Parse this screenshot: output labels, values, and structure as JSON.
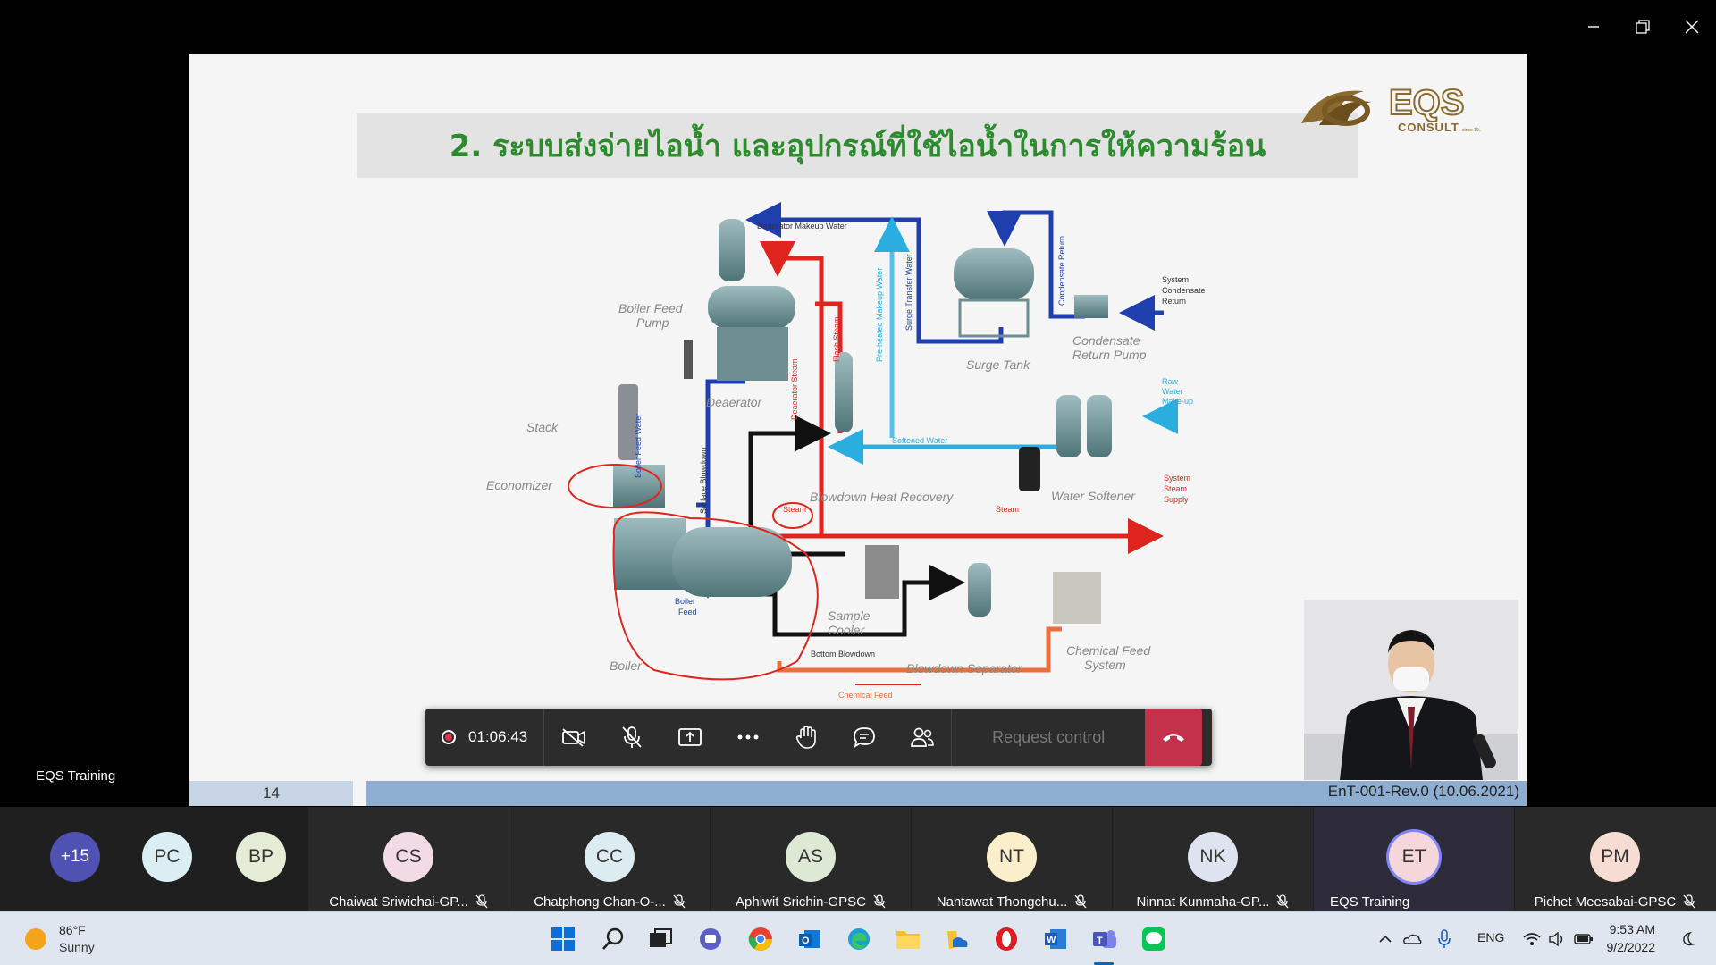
{
  "window": {
    "minimize": "minimize-icon",
    "restore": "restore-icon",
    "close": "close-icon"
  },
  "slide": {
    "title": "2. ระบบส่งจ่ายไอน้ำ และอุปกรณ์ที่ใช้ไอน้ำในการให้ความร้อน",
    "logo_brand": "EQS",
    "logo_sub": "CONSULT",
    "logo_since": "since 19..",
    "page_number": "14",
    "doc_code": "EnT-001-Rev.0 (10.06.2021)",
    "diagram": {
      "labels": {
        "boiler_feed_pump": [
          "Boiler Feed",
          "Pump"
        ],
        "deaerator": "Deaerator",
        "stack": "Stack",
        "economizer": "Economizer",
        "boiler": "Boiler",
        "blowdown_heat_recovery": "Blowdown Heat Recovery",
        "surge_tank": "Surge Tank",
        "condensate_return_pump": [
          "Condensate",
          "Return Pump"
        ],
        "water_softener": "Water Softener",
        "sample_cooler": [
          "Sample",
          "Cooler"
        ],
        "blowdown_separator": "Blowdown Separator",
        "chemical_feed_system": [
          "Chemical Feed",
          "System"
        ],
        "deaerator_makeup_water": "Deaerator Makeup Water",
        "system_condensate_return": [
          "System",
          "Condensate",
          "Return"
        ],
        "raw_water_makeup": [
          "Raw",
          "Water",
          "Make-up"
        ],
        "system_steam_supply": [
          "System",
          "Steam",
          "Supply"
        ],
        "softened_water": "Softened Water",
        "steam": "Steam",
        "steam_small": "Steam",
        "bottom_blowdown": "Bottom Blowdown",
        "chemical_feed": "Chemical Feed",
        "boiler_feed": [
          "Boiler",
          "Feed"
        ],
        "boiler_feed_water": "Boiler Feed Water",
        "surface_blowdown": "Surface Blowdown",
        "deaerator_steam": "Deaerator Steam",
        "flash_steam": "Flash Steam",
        "preheated_makeup_water": "Pre-heated Makeup Water",
        "surge_transfer_water": "Surge Transfer Water",
        "condensate_return": "Condensate Return"
      }
    }
  },
  "presenter": {
    "name": "EQS Training"
  },
  "call": {
    "timer": "01:06:43",
    "request_control": "Request control",
    "meeting_name": "EQS Training"
  },
  "participants": {
    "overflow": {
      "label": "+15",
      "color": "#4f52b2"
    },
    "small": [
      {
        "initials": "PC",
        "color": "#daeef3"
      },
      {
        "initials": "BP",
        "color": "#e5ecd6"
      }
    ],
    "tiles": [
      {
        "initials": "CS",
        "name": "Chaiwat Sriwichai-GP...",
        "color": "#f3dbe6"
      },
      {
        "initials": "CC",
        "name": "Chatphong Chan-O-...",
        "color": "#dcecf1"
      },
      {
        "initials": "AS",
        "name": "Aphiwit Srichin-GPSC",
        "color": "#dde9d4"
      },
      {
        "initials": "NT",
        "name": "Nantawat Thongchu...",
        "color": "#fbeecb"
      },
      {
        "initials": "NK",
        "name": "Ninnat Kunmaha-GP...",
        "color": "#dfe3f0"
      },
      {
        "initials": "ET",
        "name": "EQS Training",
        "color": "#f5d6da"
      },
      {
        "initials": "PM",
        "name": "Pichet Meesabai-GPSC",
        "color": "#f6dcd3"
      }
    ]
  },
  "taskbar": {
    "weather_temp": "86°F",
    "weather_condition": "Sunny",
    "language": "ENG",
    "time": "9:53 AM",
    "date": "9/2/2022"
  }
}
